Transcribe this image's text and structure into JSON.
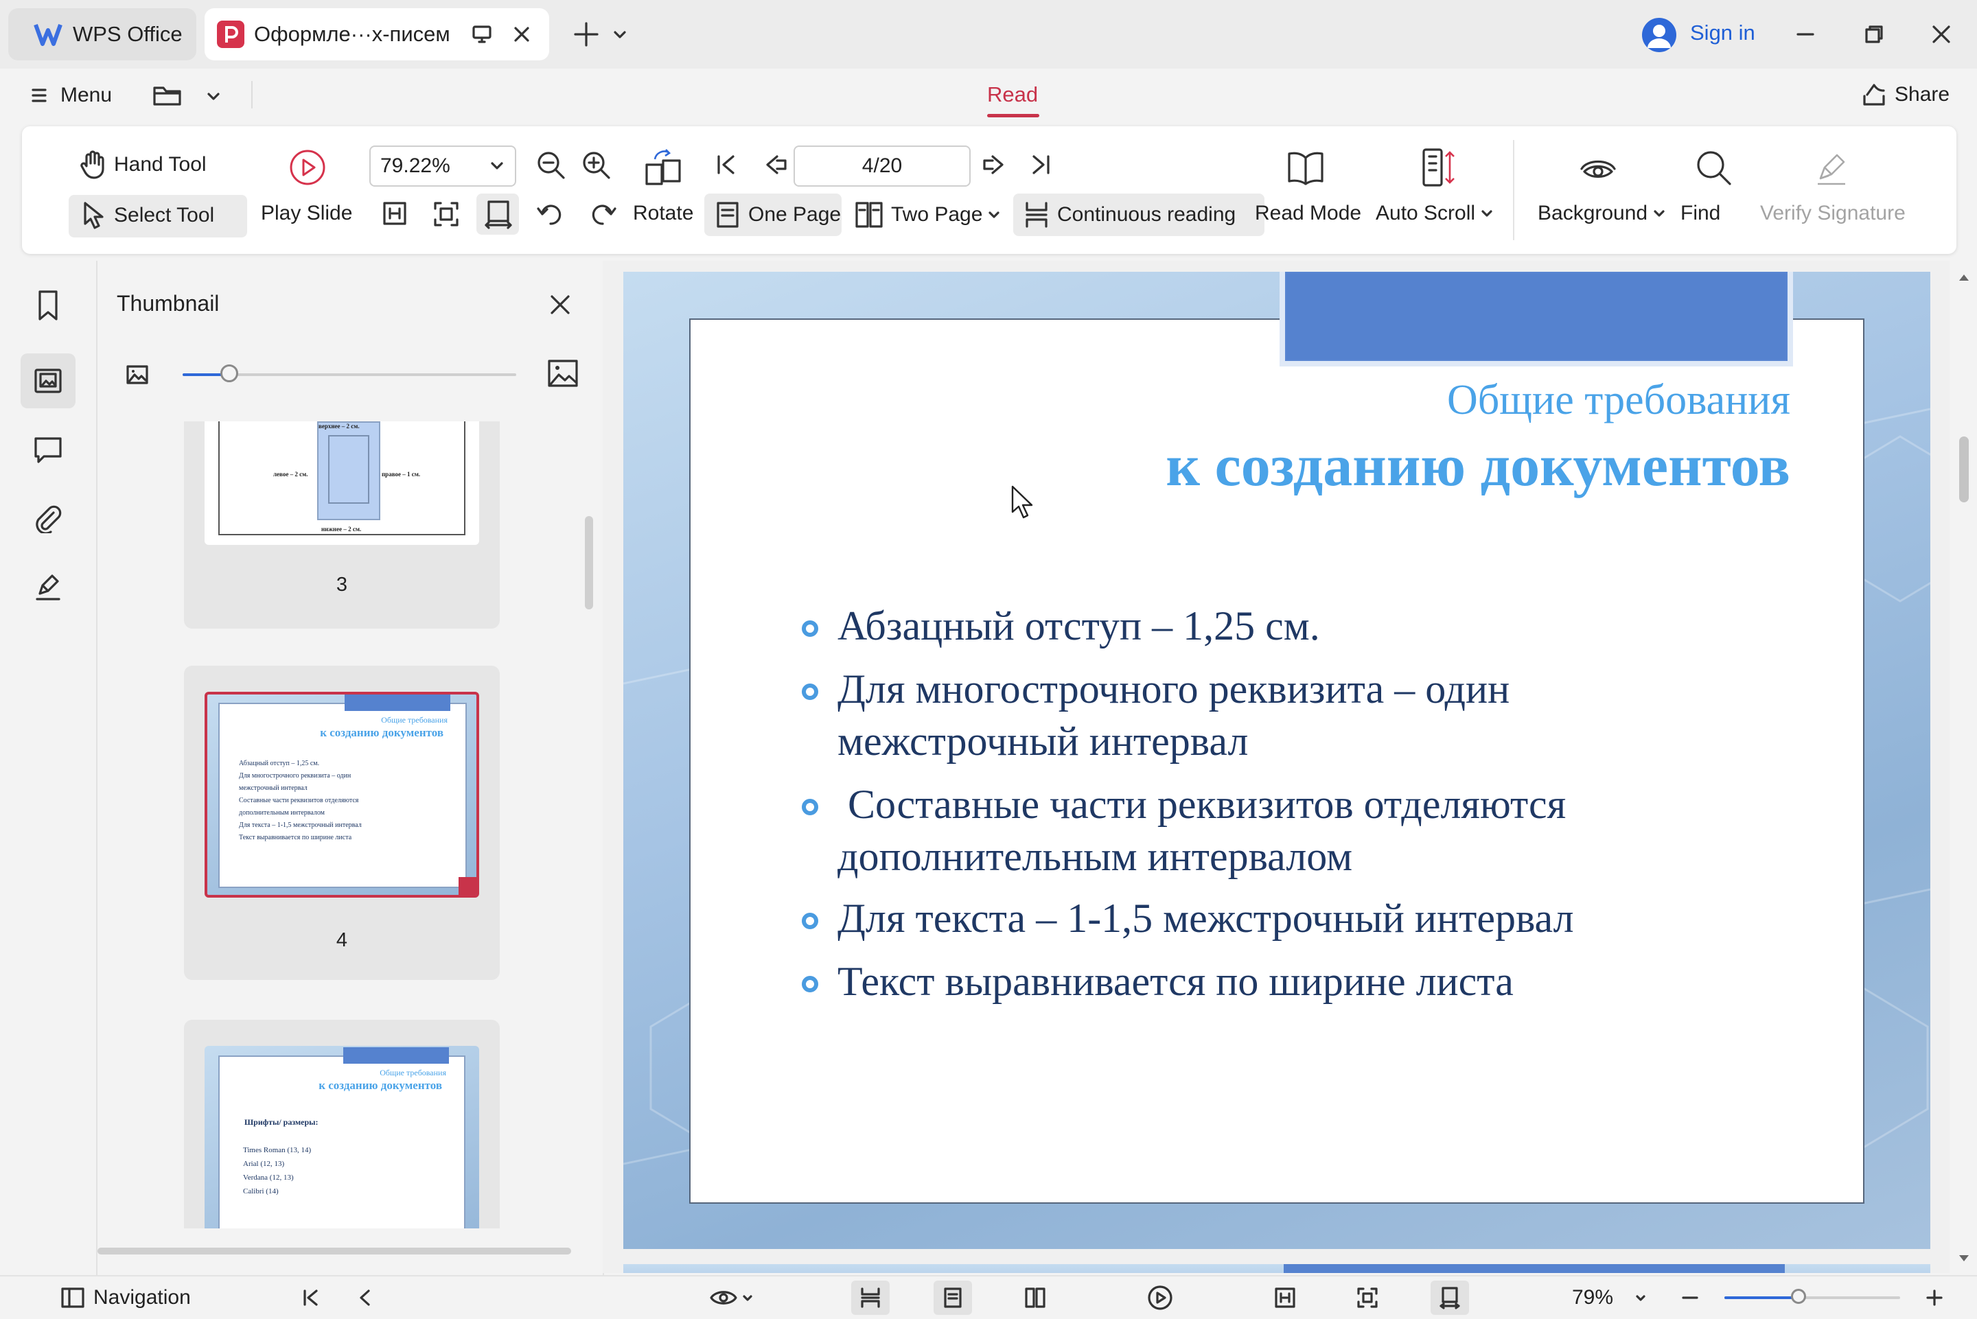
{
  "titlebar": {
    "home_tab": "WPS Office",
    "doc_tab": "Оформле···х-писем",
    "sign_in": "Sign in"
  },
  "menubar": {
    "menu": "Menu",
    "center_tab": "Read",
    "share": "Share"
  },
  "ribbon": {
    "hand_tool": "Hand Tool",
    "select_tool": "Select Tool",
    "play_slide": "Play Slide",
    "zoom_value": "79.22%",
    "page_value": "4/20",
    "rotate": "Rotate",
    "one_page": "One Page",
    "two_page": "Two Page",
    "continuous": "Continuous reading",
    "read_mode": "Read Mode",
    "auto_scroll": "Auto Scroll",
    "background": "Background",
    "find": "Find",
    "verify_signature": "Verify Signature"
  },
  "thumbnail_panel": {
    "title": "Thumbnail",
    "slider_fraction": 0.14,
    "thumbs": [
      {
        "number": "3",
        "top_label": "верхнее – 2 см.",
        "left_label": "левое – 2 см.",
        "right_label": "правое – 1 см.",
        "bottom_label": "нижнее – 2 см."
      },
      {
        "number": "4",
        "title1": "Общие требования",
        "title2": "к созданию документов",
        "bullets": [
          "Абзацный отступ – 1,25 см.",
          "Для многострочного реквизита – один",
          "межстрочный интервал",
          "Составные части реквизитов отделяются",
          "дополнительным интервалом",
          "Для текста – 1-1,5 межстрочный интервал",
          "Текст выравнивается по ширине листа"
        ]
      },
      {
        "number": "5",
        "title1": "Общие требования",
        "title2": "к созданию документов",
        "subhead": "Шрифты/ размеры:",
        "bullets": [
          "Times Roman (13, 14)",
          "Arial (12, 13)",
          "Verdana (12, 13)",
          "Calibri (14)"
        ]
      }
    ]
  },
  "slide": {
    "title1": "Общие требования",
    "title2": "к созданию документов",
    "bullets": [
      "Абзацный отступ – 1,25 см.",
      "Для многострочного реквизита – один",
      "межстрочный интервал",
      " Составные части реквизитов отделяются",
      "дополнительным интервалом",
      "Для текста – 1-1,5 межстрочный интервал",
      "Текст выравнивается по ширине листа"
    ]
  },
  "statusbar": {
    "navigation": "Navigation",
    "zoom": "79%",
    "zoom_fraction": 0.42
  },
  "colors": {
    "accent": "#c8334a",
    "link_blue": "#1f5fd6",
    "slide_title": "#4aa3e8",
    "slide_text": "#1f3864",
    "slide_blue_bar": "#5582cf"
  }
}
